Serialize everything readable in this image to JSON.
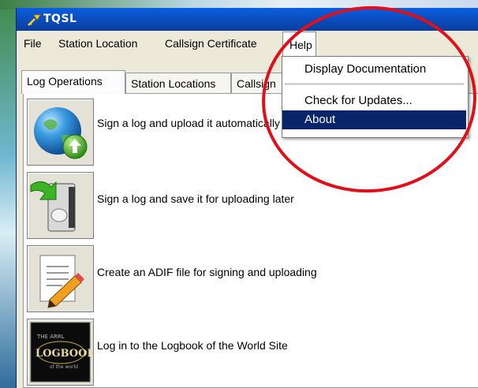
{
  "window": {
    "title": "TQSL"
  },
  "menubar": {
    "items": [
      "File",
      "Station Location",
      "Callsign Certificate"
    ],
    "help_label": "Help"
  },
  "tabs": [
    {
      "label": "Log Operations"
    },
    {
      "label": "Station Locations"
    },
    {
      "label": "Callsign"
    }
  ],
  "operations": [
    {
      "label": "Sign a log and upload it automatically",
      "icon": "globe-upload-icon"
    },
    {
      "label": "Sign a log and save it for uploading later",
      "icon": "save-file-icon"
    },
    {
      "label": "Create an ADIF file for signing and uploading",
      "icon": "document-pencil-icon"
    },
    {
      "label": "Log in to the Logbook of the World Site",
      "icon": "logbook-logo-icon"
    }
  ],
  "help_menu": {
    "items": [
      {
        "label": "Display Documentation"
      },
      {
        "label": "Check for Updates..."
      },
      {
        "label": "About",
        "selected": true
      }
    ]
  },
  "annotation": {
    "color": "#e0101a"
  }
}
